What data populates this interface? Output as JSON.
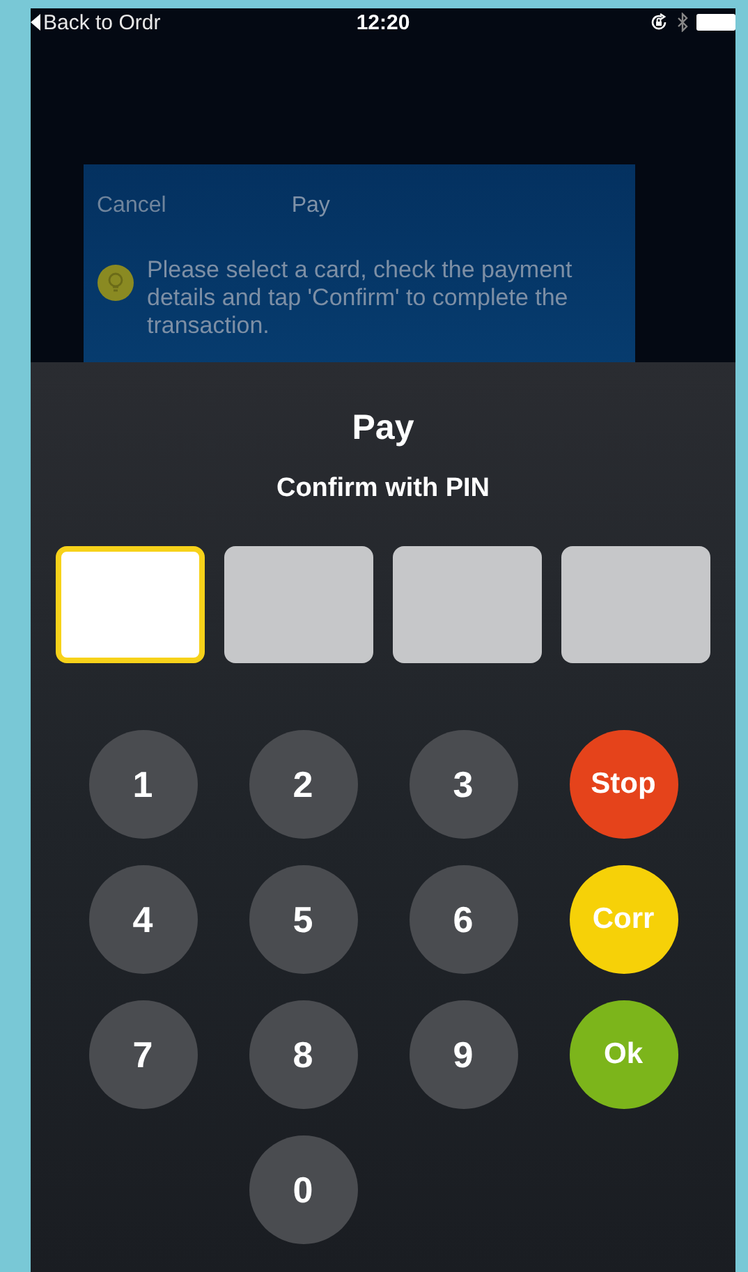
{
  "status_bar": {
    "back_label": "Back to Ordr",
    "time": "12:20"
  },
  "background_dialog": {
    "cancel": "Cancel",
    "title": "Pay",
    "message": "Please select a card, check the payment details and tap 'Confirm' to complete the transaction."
  },
  "pin_sheet": {
    "title": "Pay",
    "subtitle": "Confirm with PIN",
    "pin_slots": [
      {
        "selected": true
      },
      {
        "selected": false
      },
      {
        "selected": false
      },
      {
        "selected": false
      }
    ],
    "keypad_rows": [
      [
        {
          "label": "1",
          "kind": "digit"
        },
        {
          "label": "2",
          "kind": "digit"
        },
        {
          "label": "3",
          "kind": "digit"
        },
        {
          "label": "Stop",
          "kind": "action",
          "color": "#e5431b"
        }
      ],
      [
        {
          "label": "4",
          "kind": "digit"
        },
        {
          "label": "5",
          "kind": "digit"
        },
        {
          "label": "6",
          "kind": "digit"
        },
        {
          "label": "Corr",
          "kind": "action",
          "color": "#f6d108"
        }
      ],
      [
        {
          "label": "7",
          "kind": "digit"
        },
        {
          "label": "8",
          "kind": "digit"
        },
        {
          "label": "9",
          "kind": "digit"
        },
        {
          "label": "Ok",
          "kind": "action",
          "color": "#7cb51b"
        }
      ],
      [
        {
          "label": "0",
          "kind": "digit"
        }
      ]
    ]
  }
}
